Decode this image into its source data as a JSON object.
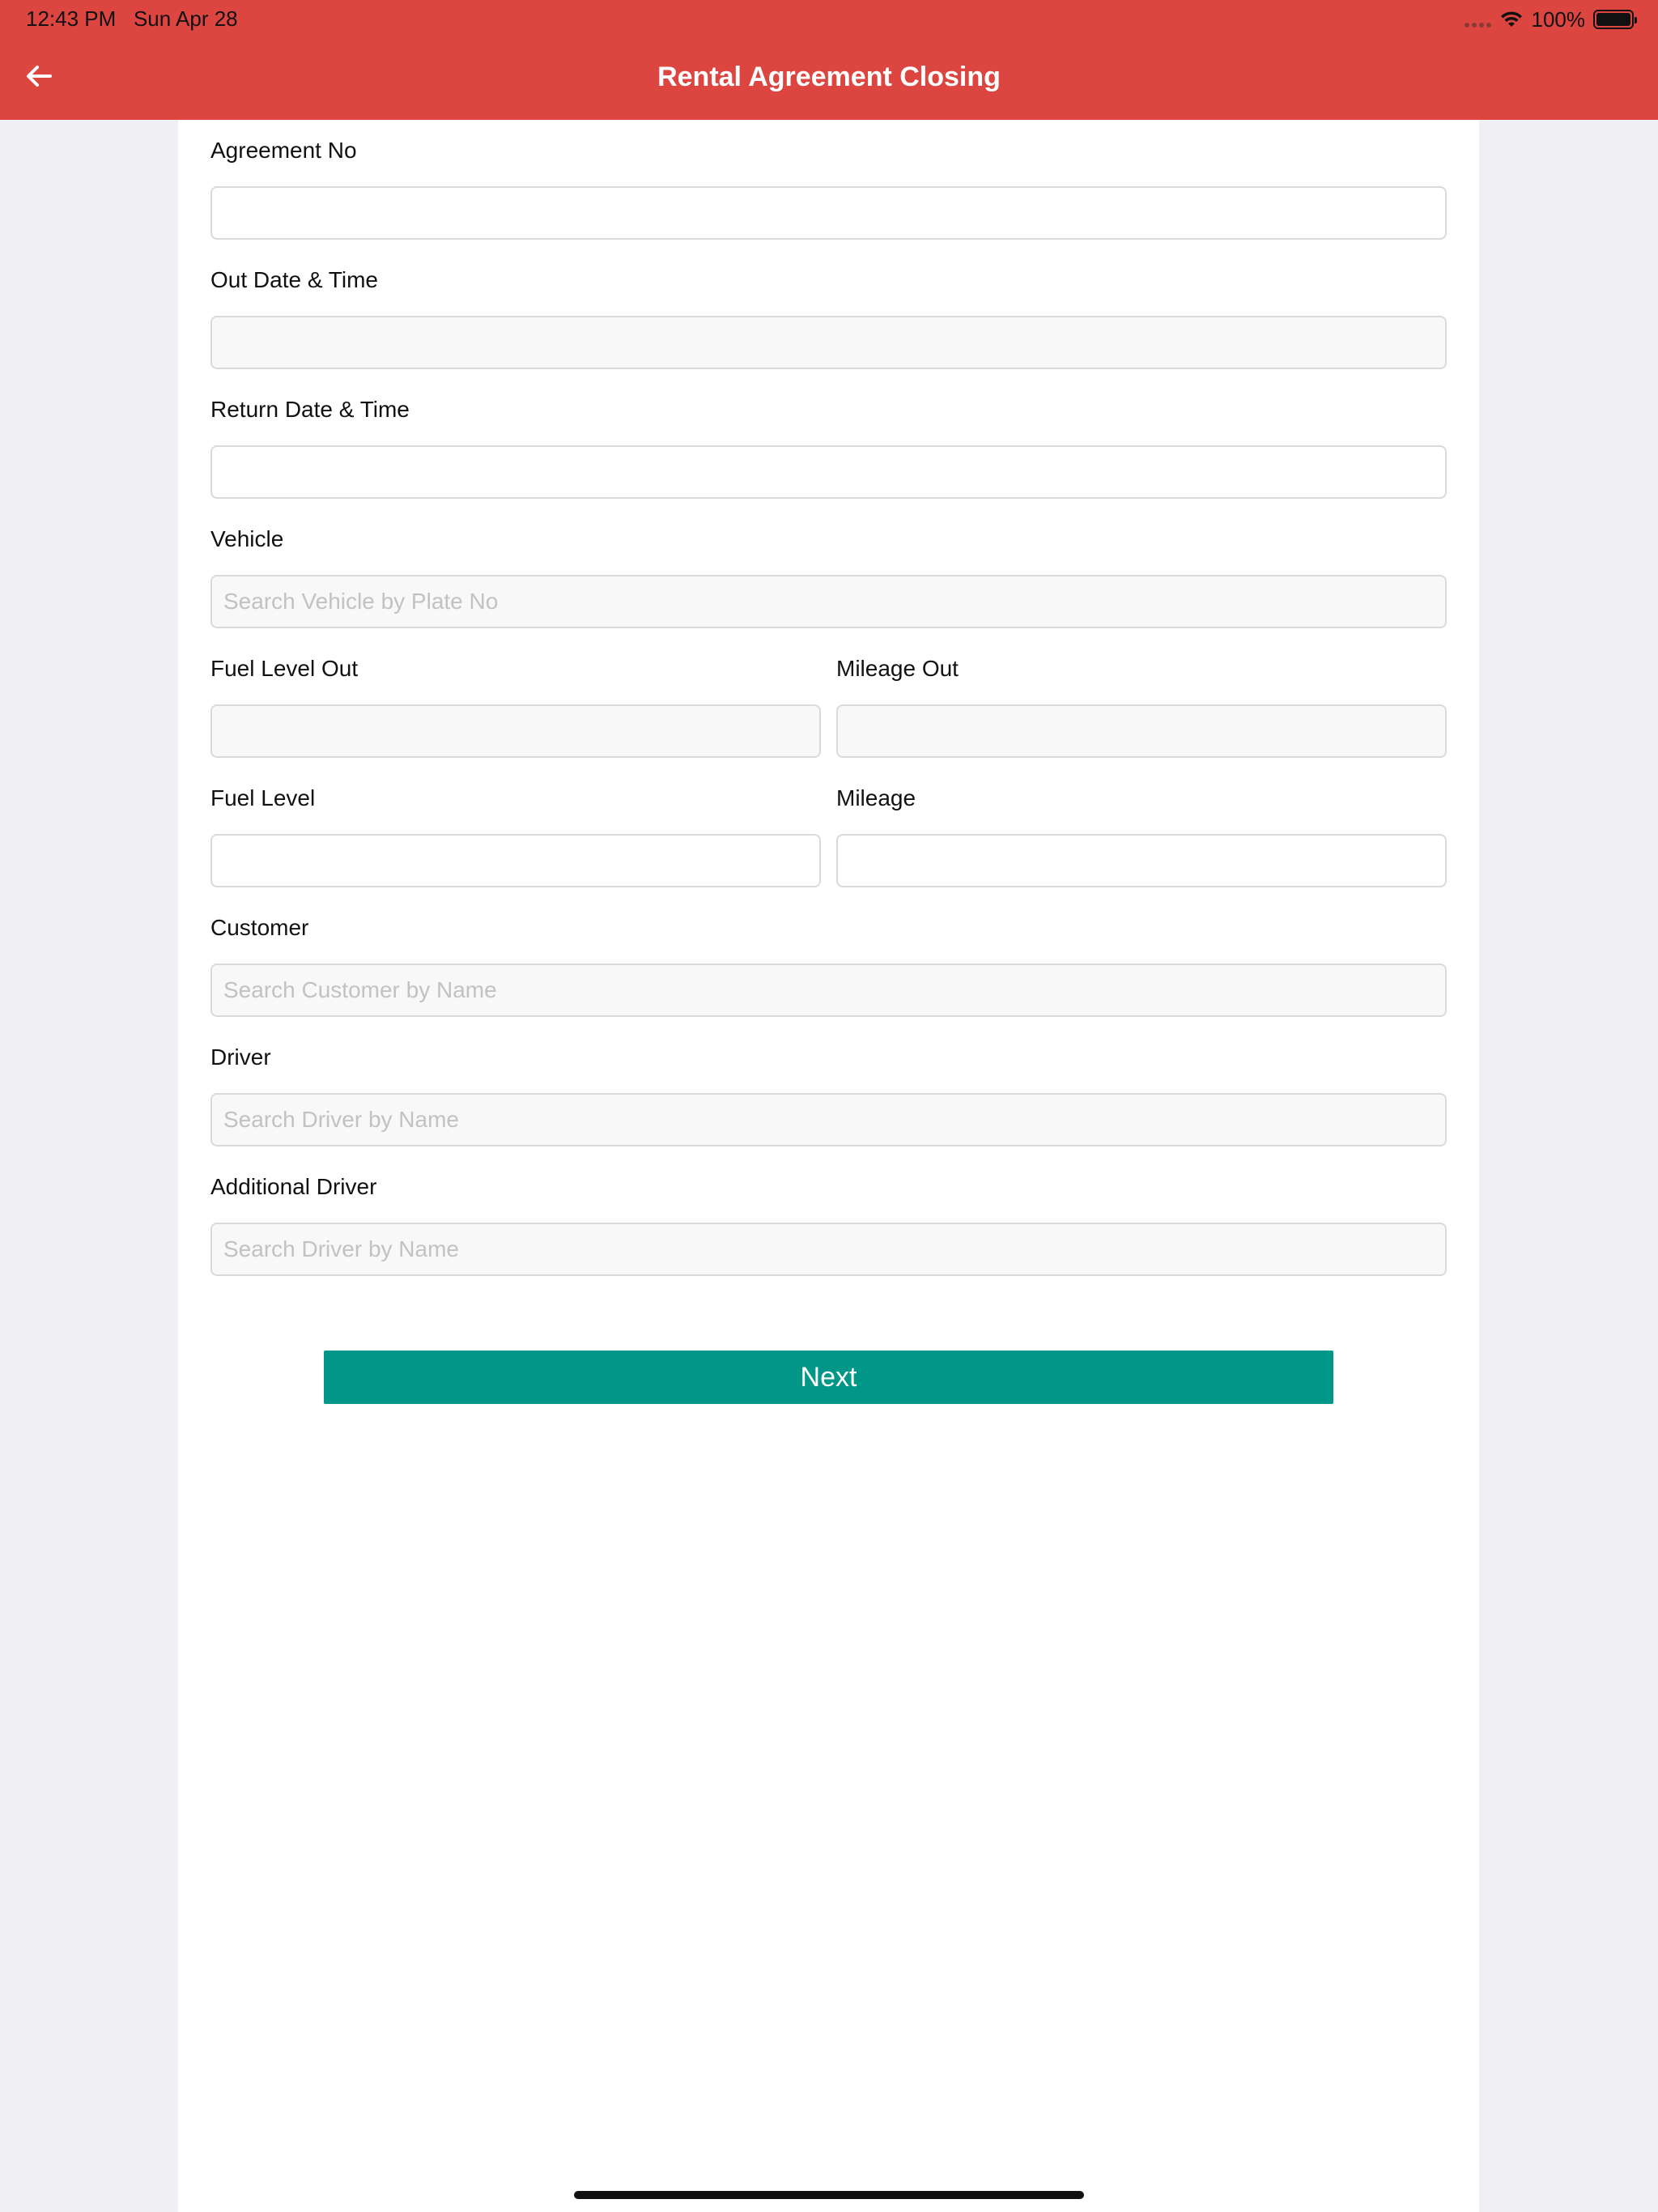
{
  "status_bar": {
    "time": "12:43 PM",
    "date": "Sun Apr 28",
    "battery": "100%",
    "icons": [
      "signal-icon",
      "wifi-icon",
      "battery-icon"
    ]
  },
  "header": {
    "title": "Rental Agreement Closing",
    "back_icon": "arrow-left-icon",
    "background_color": "#dc4540"
  },
  "form": {
    "agreement_no": {
      "label": "Agreement No",
      "value": "",
      "placeholder": ""
    },
    "out_date_time": {
      "label": "Out Date & Time",
      "value": "",
      "placeholder": ""
    },
    "return_date_time": {
      "label": "Return Date & Time",
      "value": "",
      "placeholder": ""
    },
    "vehicle": {
      "label": "Vehicle",
      "value": "",
      "placeholder": "Search Vehicle by Plate No"
    },
    "fuel_level_out": {
      "label": "Fuel Level Out",
      "value": "",
      "placeholder": ""
    },
    "mileage_out": {
      "label": "Mileage Out",
      "value": "",
      "placeholder": ""
    },
    "fuel_level": {
      "label": "Fuel Level",
      "value": "",
      "placeholder": ""
    },
    "mileage": {
      "label": "Mileage",
      "value": "",
      "placeholder": ""
    },
    "customer": {
      "label": "Customer",
      "value": "",
      "placeholder": "Search Customer by Name"
    },
    "driver": {
      "label": "Driver",
      "value": "",
      "placeholder": "Search Driver by Name"
    },
    "additional_driver": {
      "label": "Additional Driver",
      "value": "",
      "placeholder": "Search Driver by Name"
    }
  },
  "actions": {
    "next_label": "Next",
    "next_color": "#009688"
  }
}
